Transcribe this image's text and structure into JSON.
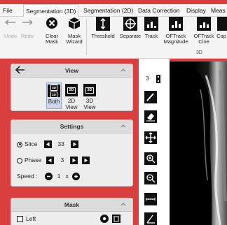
{
  "menu": {
    "items": [
      {
        "label": "File",
        "active": false
      },
      {
        "label": "Segmentation (3D)",
        "active": true
      },
      {
        "label": "Segmentation (2D)",
        "active": false
      },
      {
        "label": "Data Correction",
        "active": false
      },
      {
        "label": "Display",
        "active": false
      },
      {
        "label": "Meas",
        "active": false
      }
    ]
  },
  "ribbon": {
    "undo": "Undo",
    "redo": "Redo",
    "clear_mask": "Clear\nMask",
    "mask_wizard": "Mask\nWizard",
    "threshold": "Threshold",
    "separate": "Separate",
    "track": "Track",
    "oftrack_magnitude": "OFTrack\nMagnitude",
    "oftrack_cine": "OFTrack\nCine",
    "cop": "Cop",
    "group_3d": "3D"
  },
  "view_panel": {
    "title": "View",
    "both": "Both",
    "two_d": "2D\nView",
    "three_d": "3D\nView",
    "icon_both": "3D 2D",
    "icon_2d": "2D",
    "icon_3d": "3D",
    "selected": "Both"
  },
  "settings_panel": {
    "title": "Settings",
    "slice_label": "Slice",
    "slice_value": "33",
    "phase_label": "Phase",
    "phase_value": "3",
    "speed_label": "Speed :",
    "speed_value": "1",
    "speed_x": "x"
  },
  "mask_panel": {
    "title": "Mask",
    "left_label": "Left"
  },
  "tool_column": {
    "counter": "3"
  },
  "colors": {
    "background": "#d93f3f",
    "panel": "#ededed",
    "header": "#dcdcdc"
  }
}
